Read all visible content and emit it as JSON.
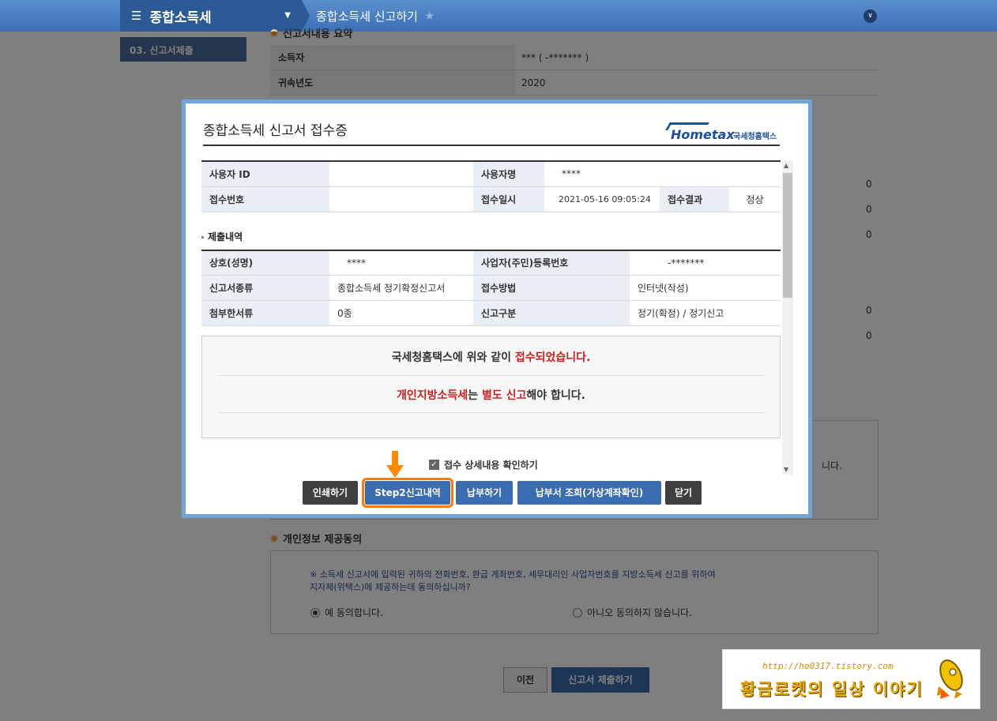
{
  "topbar": {
    "menu_label": "종합소득세",
    "breadcrumb": "종합소득세 신고하기"
  },
  "sidebar": {
    "active_tab": "03. 신고서제출"
  },
  "background": {
    "section_title": "신고서내용 요약",
    "rows": [
      {
        "label": "소득자",
        "value": "*** (             -*******  )"
      },
      {
        "label": "귀속년도",
        "value": "2020"
      }
    ],
    "right_values": [
      "0",
      "0",
      "0",
      "0",
      "0"
    ],
    "notice_tail": "니다.",
    "privacy": {
      "title": "개인정보 제공동의",
      "line1": "※ 소득세 신고서에 입력된 귀하의 전화번호, 환급 계좌번호, 세무대리인 사업자번호를 지방소득세 신고를 위하여",
      "line2": "지자체(위택스)에 제공하는데 동의하십니까?",
      "yes": "예 동의합니다.",
      "no": "아니오 동의하지 않습니다."
    },
    "prev_button": "이전",
    "submit_button": "신고서 제출하기"
  },
  "modal": {
    "title": "종합소득세 신고서 접수증",
    "logo_text": "Hometax",
    "logo_sub": "국세청홈택스",
    "receipt": {
      "user_id_label": "사용자 ID",
      "user_id_value": "",
      "user_name_label": "사용자명",
      "user_name_value": "****",
      "receipt_no_label": "접수번호",
      "receipt_no_value": "",
      "receipt_date_label": "접수일시",
      "receipt_date_value": "2021-05-16 09:05:24",
      "result_label": "접수결과",
      "result_value": "정상"
    },
    "submission_title": "제출내역",
    "submission": {
      "name_label": "상호(성명)",
      "name_value": "****",
      "reg_label": "사업자(주민)등록번호",
      "reg_value": "-*******",
      "type_label": "신고서종류",
      "type_value": "종합소득세 정기확정신고서",
      "method_label": "접수방법",
      "method_value": "인터넷(작성)",
      "attach_label": "첨부한서류",
      "attach_value": "0종",
      "category_label": "신고구분",
      "category_value": "정기(확정) / 정기신고"
    },
    "notice": {
      "line1_pre": "국세청홈택스에 위와 같이 ",
      "line1_red": "접수되었습니다.",
      "line2_red1": "개인지방소득세",
      "line2_mid": "는 ",
      "line2_red2": "별도 신고",
      "line2_post": "해야 합니다."
    },
    "confirm_label": "접수 상세내용 확인하기",
    "buttons": {
      "print": "인쇄하기",
      "step2": "Step2신고내역",
      "pay": "납부하기",
      "bill": "납부서 조회(가상계좌확인)",
      "close": "닫기"
    }
  },
  "watermark": {
    "url": "http://ho0317.tistory.com",
    "blog": "황금로켓의 일상 이야기"
  },
  "colors": {
    "topbar": "#3d6fb4",
    "modal_border": "#6fa6da",
    "accent_red": "#d01c1c",
    "highlight": "#ff7a00"
  }
}
